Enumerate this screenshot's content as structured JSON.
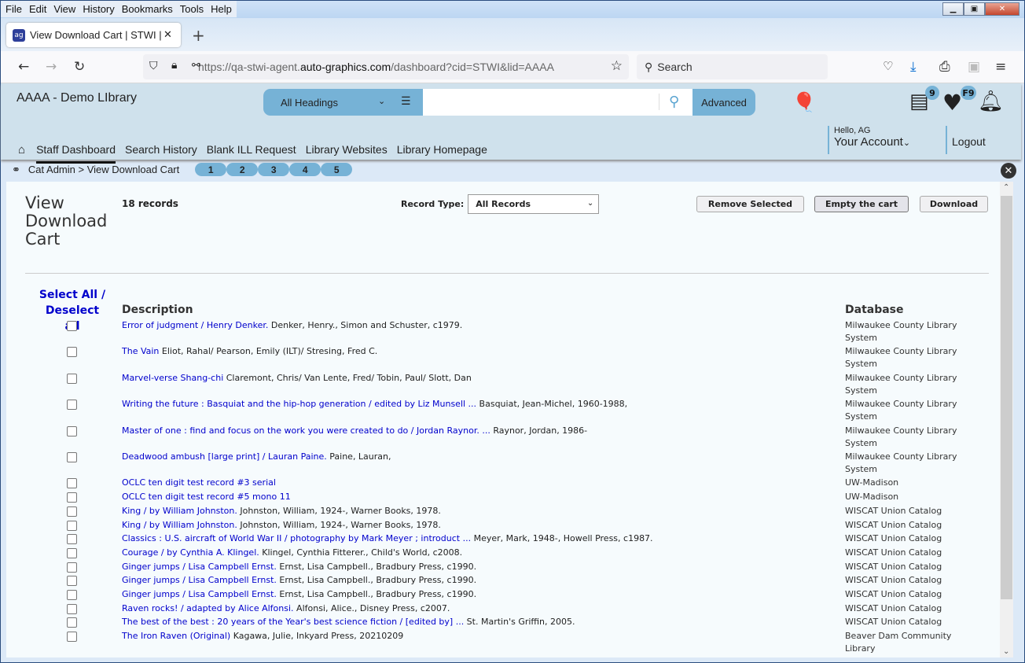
{
  "browser": {
    "menu": [
      "File",
      "Edit",
      "View",
      "History",
      "Bookmarks",
      "Tools",
      "Help"
    ],
    "tab_title": "View Download Cart | STWI | aaa",
    "url_prefix": "https://qa-stwi-agent.",
    "url_domain": "auto-graphics.com",
    "url_suffix": "/dashboard?cid=STWI&lid=AAAA",
    "search_placeholder": "Search"
  },
  "app": {
    "library_name": "AAAA - Demo LIbrary",
    "search_scope": "All Headings",
    "search_value": "",
    "advanced_label": "Advanced",
    "list_badge": "9",
    "fav_badge": "F9",
    "nav": [
      "Staff Dashboard",
      "Search History",
      "Blank ILL Request",
      "Library Websites",
      "Library Homepage"
    ],
    "greeting": "Hello, AG",
    "account_label": "Your Account",
    "logout_label": "Logout",
    "breadcrumb": "Cat Admin > View Download Cart",
    "pages": [
      "1",
      "2",
      "3",
      "4",
      "5"
    ]
  },
  "page": {
    "title": "View Download Cart",
    "record_count": "18 records",
    "record_type_label": "Record Type:",
    "record_type_value": "All Records",
    "remove_selected": "Remove Selected",
    "empty_cart": "Empty the cart",
    "download": "Download",
    "select_all": "Select All /",
    "deselect_all": "Deselect all",
    "col_description": "Description",
    "col_database": "Database",
    "records": [
      {
        "title": "Error of judgment / Henry Denker.",
        "info": " Denker, Henry., Simon and Schuster, c1979.",
        "db": "Milwaukee County Library System"
      },
      {
        "title": "The Vain",
        "info": " Eliot, Rahal/ Pearson, Emily (ILT)/ Stresing, Fred C.",
        "db": "Milwaukee County Library System"
      },
      {
        "title": "Marvel-verse Shang-chi",
        "info": " Claremont, Chris/ Van Lente, Fred/ Tobin, Paul/ Slott, Dan",
        "db": "Milwaukee County Library System"
      },
      {
        "title": "Writing the future : Basquiat and the hip-hop generation / edited by Liz Munsell ...",
        "info": " Basquiat, Jean-Michel, 1960-1988,",
        "db": "Milwaukee County Library System"
      },
      {
        "title": "Master of one : find and focus on the work you were created to do / Jordan Raynor. ...",
        "info": " Raynor, Jordan, 1986-",
        "db": "Milwaukee County Library System"
      },
      {
        "title": "Deadwood ambush [large print] / Lauran Paine.",
        "info": " Paine, Lauran,",
        "db": "Milwaukee County Library System"
      },
      {
        "title": "OCLC ten digit test record #3 serial",
        "info": "",
        "db": "UW-Madison"
      },
      {
        "title": "OCLC ten digit test record #5 mono 11",
        "info": "",
        "db": "UW-Madison"
      },
      {
        "title": "King / by William Johnston.",
        "info": " Johnston, William, 1924-, Warner Books, 1978.",
        "db": "WISCAT Union Catalog"
      },
      {
        "title": "King / by William Johnston.",
        "info": " Johnston, William, 1924-, Warner Books, 1978.",
        "db": "WISCAT Union Catalog"
      },
      {
        "title": "Classics : U.S. aircraft of World War II / photography by Mark Meyer ; introduct ...",
        "info": " Meyer, Mark, 1948-, Howell Press, c1987.",
        "db": "WISCAT Union Catalog"
      },
      {
        "title": "Courage / by Cynthia A. Klingel.",
        "info": " Klingel, Cynthia Fitterer., Child's World, c2008.",
        "db": "WISCAT Union Catalog"
      },
      {
        "title": "Ginger jumps / Lisa Campbell Ernst.",
        "info": " Ernst, Lisa Campbell., Bradbury Press, c1990.",
        "db": "WISCAT Union Catalog"
      },
      {
        "title": "Ginger jumps / Lisa Campbell Ernst.",
        "info": " Ernst, Lisa Campbell., Bradbury Press, c1990.",
        "db": "WISCAT Union Catalog"
      },
      {
        "title": "Ginger jumps / Lisa Campbell Ernst.",
        "info": " Ernst, Lisa Campbell., Bradbury Press, c1990.",
        "db": "WISCAT Union Catalog"
      },
      {
        "title": "Raven rocks! / adapted by Alice Alfonsi.",
        "info": " Alfonsi, Alice., Disney Press, c2007.",
        "db": "WISCAT Union Catalog"
      },
      {
        "title": "The best of the best : 20 years of the Year's best science fiction / [edited by] ...",
        "info": " St. Martin's Griffin, 2005.",
        "db": "WISCAT Union Catalog"
      },
      {
        "title": "The Iron Raven (Original)",
        "info": " Kagawa, Julie, Inkyard Press, 20210209",
        "db": "Beaver Dam Community Library"
      }
    ]
  },
  "colors": {
    "accent": "#76b2d6",
    "header_bg": "#cfe1ec",
    "link": "#0000cc"
  }
}
